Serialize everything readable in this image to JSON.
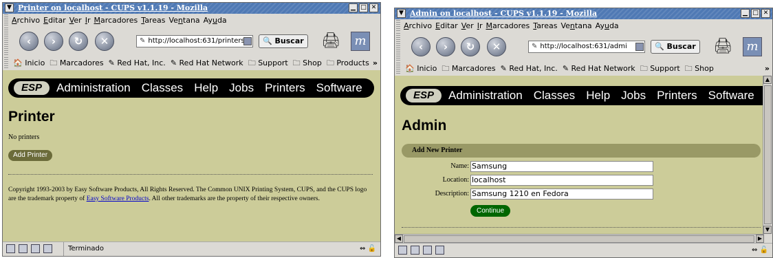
{
  "left_window": {
    "title": "Printer on localhost - CUPS v1.1.19 - Mozilla",
    "menu": [
      {
        "pre": "",
        "u": "A",
        "post": "rchivo"
      },
      {
        "pre": "",
        "u": "E",
        "post": "ditar"
      },
      {
        "pre": "",
        "u": "V",
        "post": "er"
      },
      {
        "pre": "",
        "u": "I",
        "post": "r"
      },
      {
        "pre": "",
        "u": "M",
        "post": "arcadores"
      },
      {
        "pre": "",
        "u": "T",
        "post": "areas"
      },
      {
        "pre": "Ve",
        "u": "n",
        "post": "tana"
      },
      {
        "pre": "Ay",
        "u": "u",
        "post": "da"
      }
    ],
    "url": "http://localhost:631/printers",
    "search_label": "Buscar",
    "bookmarks": [
      "Inicio",
      "Marcadores",
      "Red Hat, Inc.",
      "Red Hat Network",
      "Support",
      "Shop",
      "Products"
    ],
    "bookmark_overflow": "»",
    "esp_logo": "ESP",
    "esp_links": [
      "Administration",
      "Classes",
      "Help",
      "Jobs",
      "Printers",
      "Software"
    ],
    "page_title": "Printer",
    "no_printers": "No printers",
    "add_printer": "Add Printer",
    "copyright_before": "Copyright 1993-2003 by Easy Software Products, All Rights Reserved. The Common UNIX Printing System, CUPS, and the CUPS logo are the trademark property of ",
    "copyright_link": "Easy Software Products",
    "copyright_after": ". All other trademarks are the property of their respective owners.",
    "status_text": "Terminado"
  },
  "right_window": {
    "title": "Admin on localhost - CUPS v1.1.19 - Mozilla",
    "menu": [
      {
        "pre": "",
        "u": "A",
        "post": "rchivo"
      },
      {
        "pre": "",
        "u": "E",
        "post": "ditar"
      },
      {
        "pre": "",
        "u": "V",
        "post": "er"
      },
      {
        "pre": "",
        "u": "I",
        "post": "r"
      },
      {
        "pre": "",
        "u": "M",
        "post": "arcadores"
      },
      {
        "pre": "",
        "u": "T",
        "post": "areas"
      },
      {
        "pre": "Ve",
        "u": "n",
        "post": "tana"
      },
      {
        "pre": "Ay",
        "u": "u",
        "post": "da"
      }
    ],
    "url": "http://localhost:631/admi",
    "search_label": "Buscar",
    "bookmarks": [
      "Inicio",
      "Marcadores",
      "Red Hat, Inc.",
      "Red Hat Network",
      "Support",
      "Shop"
    ],
    "bookmark_overflow": "»",
    "esp_logo": "ESP",
    "esp_links": [
      "Administration",
      "Classes",
      "Help",
      "Jobs",
      "Printers",
      "Software"
    ],
    "page_title": "Admin",
    "section_title": "Add New Printer",
    "fields": [
      {
        "label": "Name:",
        "value": "Samsung"
      },
      {
        "label": "Location:",
        "value": "localhost"
      },
      {
        "label": "Description:",
        "value": "Samsung 1210 en Fedora"
      }
    ],
    "continue_label": "Continue"
  },
  "colors": {
    "page_bg": "#cccc99",
    "title_bar": "#4f79b4",
    "chrome": "#dcdad5",
    "esp_bar": "#000000",
    "continue": "#006600"
  }
}
